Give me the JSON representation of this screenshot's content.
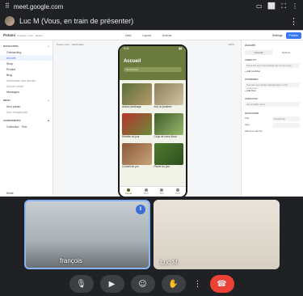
{
  "browser": {
    "url": "meet.google.com"
  },
  "presenting": {
    "text": "Luc M (Vous, en train de présenter)"
  },
  "tool": {
    "project_name": "Potami",
    "project_sub": "Collapse ·main · Master",
    "tabs": [
      "Data",
      "Layout",
      "Actions"
    ],
    "settings_label": "Settings",
    "publish_label": "Publish",
    "breadcrumb": "Potami pour · Handmade ·",
    "zoom": "100%"
  },
  "left_panel": {
    "nav_heading": "NAVIGATION",
    "nav_items": [
      "Onboarding",
      "Accueil",
      "Shop",
      "Produit",
      "Blog",
      "Information des articles",
      "Nouvel article",
      "Messages"
    ],
    "active_index": 1,
    "menu_heading": "MENU",
    "menu_items": [
      "Mon panier",
      "Mon récapitulatif"
    ],
    "components_heading": "COMPONENTS",
    "components_items": [
      "Collection · Tirer"
    ],
    "footer": "Mode"
  },
  "phone": {
    "time": "9:41",
    "title": "Accueil",
    "search_placeholder": "Rechercher",
    "tiles": [
      {
        "caption": "Astuce jardinage",
        "icon": "info-icon"
      },
      {
        "caption": "Ami du jardinier",
        "icon": "info-icon"
      },
      {
        "caption": "Recette du jour",
        "icon": "recipe-icon"
      },
      {
        "caption": "Coup de cœur floral",
        "icon": "flower-icon"
      },
      {
        "caption": "Conseil de pro",
        "icon": "tip-icon"
      },
      {
        "caption": "Plante du jour",
        "icon": "plant-icon"
      }
    ],
    "tabbar": [
      "Accueil",
      "Shop",
      "Blog",
      "Profil"
    ]
  },
  "right_panel": {
    "title": "Accueil",
    "tabs": [
      "General",
      "Options"
    ],
    "visibility_heading": "VISIBILITY",
    "visibility_text": "Show this item if something else is not empty",
    "add_condition": "+ Add condition",
    "overrides_heading": "OVERRIDES",
    "overrides_text": "Override and replace placeholders in this component",
    "add_row": "+ Add Row",
    "user_data_heading": "USER DATA",
    "user_data_value": "Set as Table name",
    "navigation_heading": "NAVIGATION",
    "nav_title_label": "Title",
    "nav_title_value": "Default title",
    "nav_slug_label": "Slug",
    "hide_label": "Hide from tab bar"
  },
  "participants": [
    {
      "name": "françois"
    },
    {
      "name": "Luc M"
    }
  ],
  "controls": {
    "labels": [
      "microphone",
      "camera",
      "reactions",
      "raise hand",
      "more",
      "leave call"
    ]
  }
}
